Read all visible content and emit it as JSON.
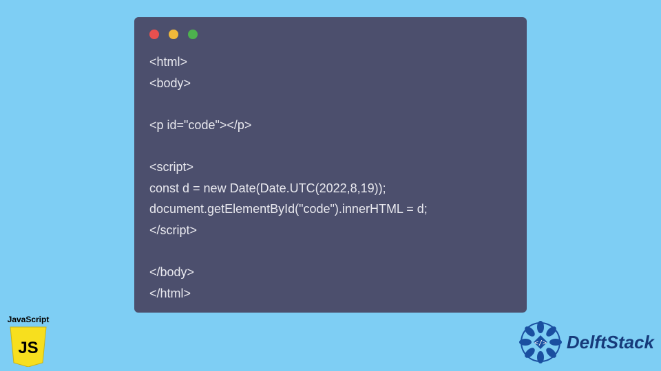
{
  "code": {
    "lines": "<html>\n<body>\n\n<p id=\"code\"></p>\n\n<script>\nconst d = new Date(Date.UTC(2022,8,19));\ndocument.getElementById(\"code\").innerHTML = d;\n</script>\n\n</body>\n</html>"
  },
  "js_badge": {
    "label": "JavaScript",
    "logo_text": "JS"
  },
  "brand": {
    "name": "DelftStack"
  }
}
